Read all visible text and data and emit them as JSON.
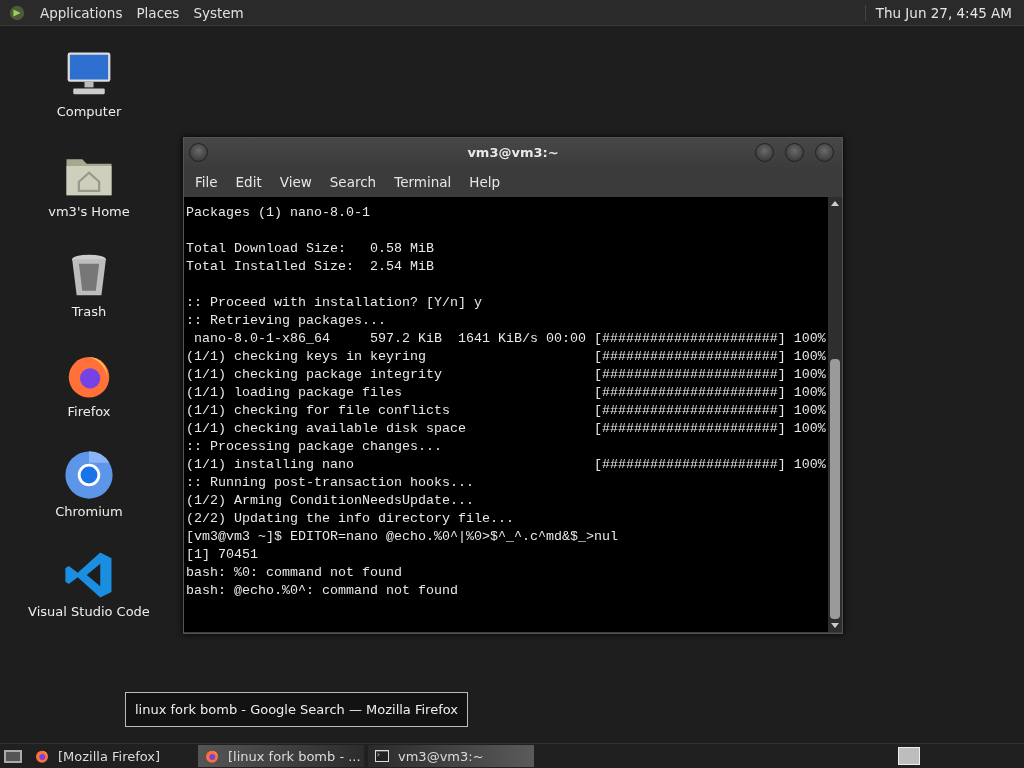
{
  "top_panel": {
    "menus": [
      "Applications",
      "Places",
      "System"
    ],
    "clock": "Thu Jun 27, 4:45 AM"
  },
  "desktop_icons": [
    {
      "label": "Computer",
      "kind": "computer"
    },
    {
      "label": "vm3's Home",
      "kind": "home"
    },
    {
      "label": "Trash",
      "kind": "trash"
    },
    {
      "label": "Firefox",
      "kind": "firefox"
    },
    {
      "label": "Chromium",
      "kind": "chromium"
    },
    {
      "label": "Visual Studio Code",
      "kind": "vscode"
    }
  ],
  "terminal_window": {
    "title": "vm3@vm3:~",
    "menu": [
      "File",
      "Edit",
      "View",
      "Search",
      "Terminal",
      "Help"
    ],
    "output_blocks": [
      [
        "Packages (1) nano-8.0-1"
      ],
      [
        "Total Download Size:   0.58 MiB",
        "Total Installed Size:  2.54 MiB"
      ],
      [
        ":: Proceed with installation? [Y/n] y",
        ":: Retrieving packages...",
        " nano-8.0-1-x86_64     597.2 KiB  1641 KiB/s 00:00 [######################] 100%",
        "(1/1) checking keys in keyring                     [######################] 100%",
        "(1/1) checking package integrity                   [######################] 100%",
        "(1/1) loading package files                        [######################] 100%",
        "(1/1) checking for file conflicts                  [######################] 100%",
        "(1/1) checking available disk space                [######################] 100%",
        ":: Processing package changes...",
        "(1/1) installing nano                              [######################] 100%",
        ":: Running post-transaction hooks...",
        "(1/2) Arming ConditionNeedsUpdate...",
        "(2/2) Updating the info directory file...",
        "[vm3@vm3 ~]$ EDITOR=nano @echo.%0^|%0>$^_^.c^md&$_>nul",
        "[1] 70451",
        "bash: %0: command not found",
        "bash: @echo.%0^: command not found"
      ]
    ]
  },
  "tooltip": "linux fork bomb - Google Search — Mozilla Firefox",
  "taskbar": {
    "tasks": [
      {
        "label": "[Mozilla Firefox]",
        "kind": "firefox",
        "selected": false,
        "hovered": false
      },
      {
        "label": "[linux fork bomb - ...",
        "kind": "firefox",
        "selected": false,
        "hovered": true
      },
      {
        "label": "vm3@vm3:~",
        "kind": "terminal",
        "selected": true,
        "hovered": false
      }
    ]
  }
}
